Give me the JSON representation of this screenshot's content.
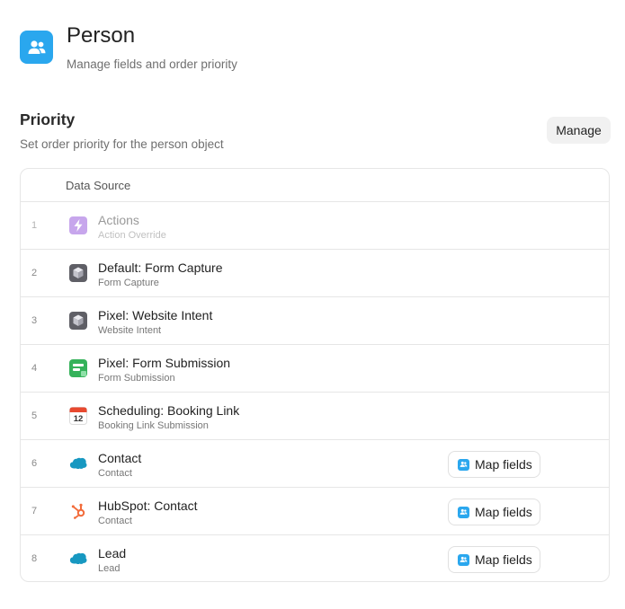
{
  "header": {
    "title": "Person",
    "subtitle": "Manage fields and order priority",
    "icon": "people-icon",
    "accent": "#2aa7ee"
  },
  "priority": {
    "title": "Priority",
    "subtitle": "Set order priority for the person object",
    "manage_label": "Manage"
  },
  "table": {
    "column_header": "Data Source",
    "rows": [
      {
        "num": "1",
        "name": "Actions",
        "sub": "Action Override",
        "icon": "lightning-icon",
        "disabled": true,
        "map": false
      },
      {
        "num": "2",
        "name": "Default: Form Capture",
        "sub": "Form Capture",
        "icon": "cube-icon",
        "map": false
      },
      {
        "num": "3",
        "name": "Pixel: Website Intent",
        "sub": "Website Intent",
        "icon": "cube-icon",
        "map": false
      },
      {
        "num": "4",
        "name": "Pixel: Form Submission",
        "sub": "Form Submission",
        "icon": "form-icon",
        "map": false
      },
      {
        "num": "5",
        "name": "Scheduling: Booking Link",
        "sub": "Booking Link Submission",
        "icon": "calendar-icon",
        "map": false
      },
      {
        "num": "6",
        "name": "Contact",
        "sub": "Contact",
        "icon": "salesforce-icon",
        "map": true
      },
      {
        "num": "7",
        "name": "HubSpot: Contact",
        "sub": "Contact",
        "icon": "hubspot-icon",
        "map": true
      },
      {
        "num": "8",
        "name": "Lead",
        "sub": "Lead",
        "icon": "salesforce-icon",
        "map": true
      }
    ],
    "map_label": "Map fields",
    "calendar_day": "12"
  }
}
